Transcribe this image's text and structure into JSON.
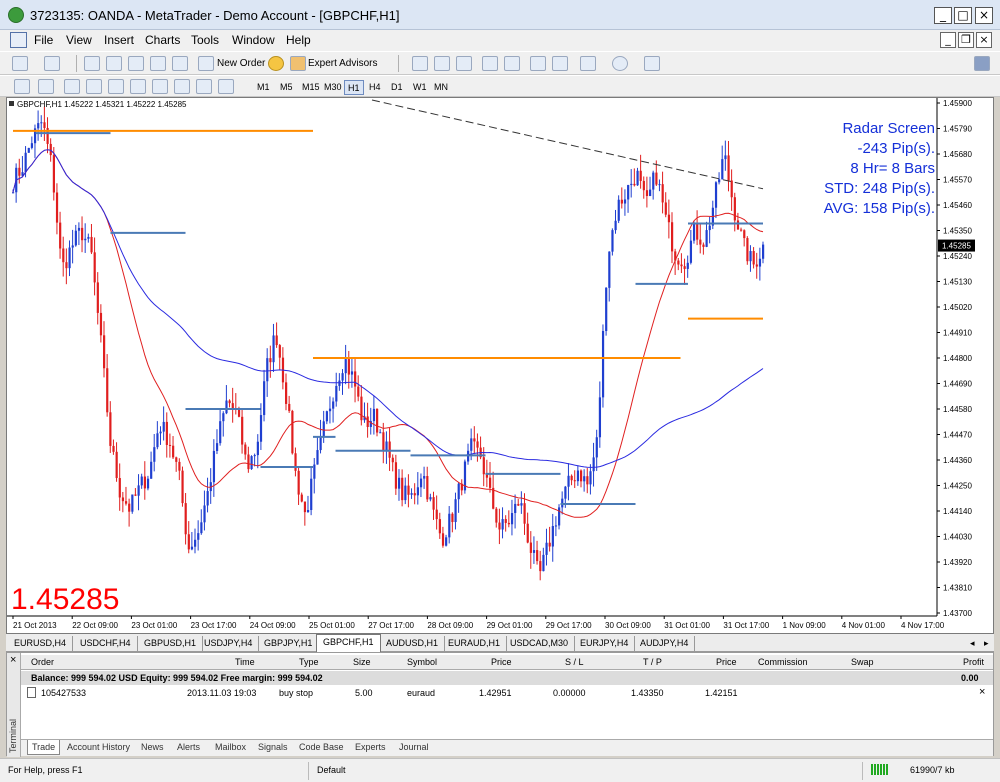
{
  "window": {
    "title": "3723135: OANDA - MetaTrader - Demo Account - [GBPCHF,H1]"
  },
  "menu": [
    "File",
    "View",
    "Insert",
    "Charts",
    "Tools",
    "Window",
    "Help"
  ],
  "toolbar": {
    "new_order": "New Order",
    "expert_advisors": "Expert Advisors"
  },
  "timeframes": [
    "M1",
    "M5",
    "M15",
    "M30",
    "H1",
    "H4",
    "D1",
    "W1",
    "MN"
  ],
  "active_timeframe": "H1",
  "chart": {
    "header": "GBPCHF,H1  1.45222 1.45321 1.45222 1.45285",
    "big_price": "1.45285",
    "radar": [
      "Radar Screen",
      "-243 Pip(s).",
      "8 Hr= 8 Bars",
      "STD: 248 Pip(s).",
      "AVG: 158 Pip(s)."
    ],
    "current_price_label": "1.45285",
    "colors": {
      "bull": "#1f3fd0",
      "bear": "#e01e1e",
      "ma_red": "#e02020",
      "ma_blue": "#2a2ae0",
      "levels": "#ff8c00",
      "steel": "#4a7ab5",
      "big_price": "#ff0000",
      "radar": "#1530d8"
    }
  },
  "chart_data": {
    "type": "candlestick",
    "symbol": "GBPCHF",
    "timeframe": "H1",
    "y_axis": [
      "1.45900",
      "1.45790",
      "1.45680",
      "1.45570",
      "1.45460",
      "1.45350",
      "1.45240",
      "1.45130",
      "1.45020",
      "1.44910",
      "1.44800",
      "1.44690",
      "1.44580",
      "1.44470",
      "1.44360",
      "1.44250",
      "1.44140",
      "1.44030",
      "1.43920",
      "1.43810",
      "1.43700"
    ],
    "x_axis": [
      "21 Oct 2013",
      "22 Oct 09:00",
      "23 Oct 01:00",
      "23 Oct 17:00",
      "24 Oct 09:00",
      "25 Oct 01:00",
      "27 Oct 17:00",
      "28 Oct 09:00",
      "29 Oct 01:00",
      "29 Oct 17:00",
      "30 Oct 09:00",
      "31 Oct 01:00",
      "31 Oct 17:00",
      "1 Nov 09:00",
      "4 Nov 01:00",
      "4 Nov 17:00"
    ],
    "ylim": [
      1.437,
      1.459
    ],
    "close_path": [
      1.4556,
      1.4563,
      1.4575,
      1.4582,
      1.4562,
      1.4518,
      1.4528,
      1.4535,
      1.4526,
      1.4487,
      1.4443,
      1.4422,
      1.4415,
      1.4424,
      1.4431,
      1.4452,
      1.4445,
      1.443,
      1.4398,
      1.4405,
      1.4422,
      1.4445,
      1.4462,
      1.4455,
      1.4433,
      1.4441,
      1.4475,
      1.4491,
      1.4465,
      1.443,
      1.4412,
      1.4432,
      1.4451,
      1.4468,
      1.448,
      1.447,
      1.4451,
      1.4455,
      1.4445,
      1.4431,
      1.4421,
      1.442,
      1.4432,
      1.4415,
      1.4402,
      1.4411,
      1.4426,
      1.4441,
      1.4438,
      1.442,
      1.4406,
      1.441,
      1.4419,
      1.44,
      1.4385,
      1.44,
      1.4415,
      1.4425,
      1.4432,
      1.4425,
      1.4445,
      1.4523,
      1.4545,
      1.4552,
      1.456,
      1.4545,
      1.456,
      1.454,
      1.4525,
      1.4522,
      1.4535,
      1.453,
      1.4548,
      1.4568,
      1.4545,
      1.4528,
      1.452,
      1.4528
    ],
    "levels": [
      {
        "price": 1.4578,
        "from": 0.0,
        "to": 0.4,
        "color": "orange"
      },
      {
        "price": 1.448,
        "from": 0.4,
        "to": 0.89,
        "color": "orange"
      },
      {
        "price": 1.4497,
        "from": 0.9,
        "to": 1.0,
        "color": "orange"
      },
      {
        "price": 1.4577,
        "from": 0.03,
        "to": 0.13,
        "color": "steel"
      },
      {
        "price": 1.4534,
        "from": 0.13,
        "to": 0.23,
        "color": "steel"
      },
      {
        "price": 1.4458,
        "from": 0.23,
        "to": 0.33,
        "color": "steel"
      },
      {
        "price": 1.4433,
        "from": 0.33,
        "to": 0.4,
        "color": "steel"
      },
      {
        "price": 1.4446,
        "from": 0.4,
        "to": 0.43,
        "color": "steel"
      },
      {
        "price": 1.444,
        "from": 0.43,
        "to": 0.53,
        "color": "steel"
      },
      {
        "price": 1.4438,
        "from": 0.53,
        "to": 0.63,
        "color": "steel"
      },
      {
        "price": 1.443,
        "from": 0.63,
        "to": 0.73,
        "color": "steel"
      },
      {
        "price": 1.4417,
        "from": 0.73,
        "to": 0.83,
        "color": "steel"
      },
      {
        "price": 1.4512,
        "from": 0.83,
        "to": 0.9,
        "color": "steel"
      },
      {
        "price": 1.4538,
        "from": 0.9,
        "to": 1.0,
        "color": "steel"
      }
    ]
  },
  "chart_tabs": [
    "EURUSD,H4",
    "USDCHF,H4",
    "GBPUSD,H1",
    "USDJPY,H4",
    "GBPJPY,H1",
    "GBPCHF,H1",
    "AUDUSD,H1",
    "EURAUD,H1",
    "USDCAD,M30",
    "EURJPY,H4",
    "AUDJPY,H4"
  ],
  "active_chart_tab": "GBPCHF,H1",
  "terminal": {
    "side_label": "Terminal",
    "columns": [
      "Order",
      "Time",
      "Type",
      "Size",
      "Symbol",
      "Price",
      "S / L",
      "T / P",
      "Price",
      "Commission",
      "Swap",
      "Profit"
    ],
    "balance_text": "Balance: 999 594.02 USD  Equity: 999 594.02  Free margin: 999 594.02",
    "balance_profit": "0.00",
    "orders": [
      {
        "order": "105427533",
        "time": "2013.11.03 19:03",
        "type": "buy stop",
        "size": "5.00",
        "symbol": "euraud",
        "price": "1.42951",
        "sl": "0.00000",
        "tp": "1.43350",
        "cur_price": "1.42151"
      }
    ],
    "tabs": [
      "Trade",
      "Account History",
      "News",
      "Alerts",
      "Mailbox",
      "Signals",
      "Code Base",
      "Experts",
      "Journal"
    ],
    "active_tab": "Trade"
  },
  "status": {
    "help": "For Help, press F1",
    "profile": "Default",
    "traffic": "61990/7 kb"
  }
}
